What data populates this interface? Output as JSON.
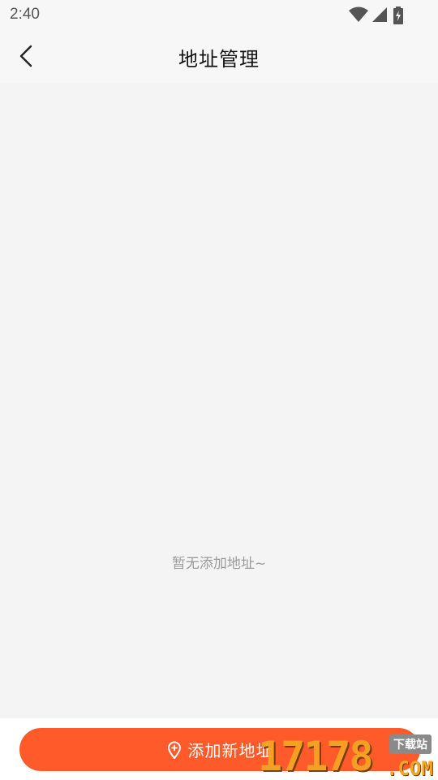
{
  "status_bar": {
    "time": "2:40",
    "icons": [
      "wifi-icon",
      "cellular-signal-icon",
      "battery-charging-icon"
    ]
  },
  "header": {
    "back_icon": "chevron-left-icon",
    "title": "地址管理"
  },
  "main": {
    "empty_message": "暂无添加地址~"
  },
  "footer": {
    "add_button_label": "添加新地址",
    "add_button_icon": "location-pin-icon"
  },
  "watermark": {
    "digits": "17178",
    "domain": ".COM",
    "badge": "下载站"
  },
  "colors": {
    "accent": "#ff5a29",
    "background": "#f4f4f4",
    "header_background": "#f7f7f7",
    "empty_text": "#9a9a9a"
  }
}
